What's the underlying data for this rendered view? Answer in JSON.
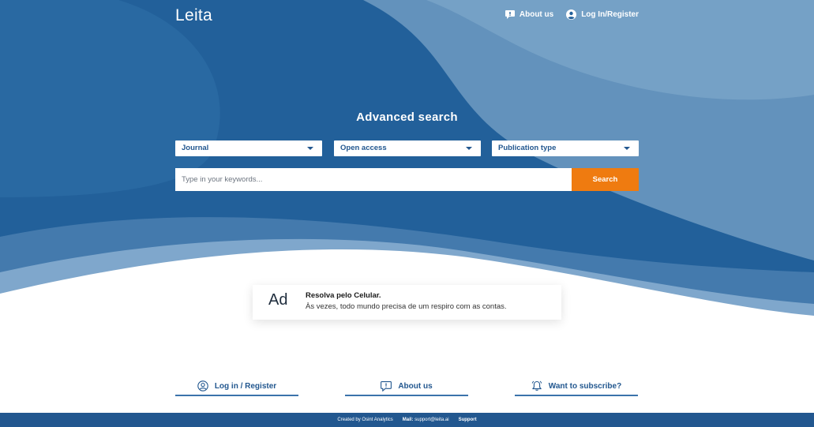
{
  "app": {
    "logo": "Leita"
  },
  "header": {
    "nav": [
      {
        "label": "About us",
        "icon": "speech-bubble-icon"
      },
      {
        "label": "Log In/Register",
        "icon": "user-circle-icon"
      }
    ]
  },
  "search": {
    "title": "Advanced search",
    "filters": [
      {
        "label": "Journal"
      },
      {
        "label": "Open access"
      },
      {
        "label": "Publication type"
      }
    ],
    "placeholder": "Type in your keywords...",
    "button_label": "Search"
  },
  "ad": {
    "tag": "Ad",
    "title": "Resolva pelo Celular.",
    "text": "Às vezes, todo mundo precisa de um respiro com as contas."
  },
  "footer_links": [
    {
      "label": "Log in / Register",
      "icon": "user-circle-icon"
    },
    {
      "label": "About us",
      "icon": "speech-bubble-icon"
    },
    {
      "label": "Want to subscribe?",
      "icon": "bell-icon"
    }
  ],
  "footer": {
    "created_by": "Created by Osint Analytics",
    "mail_label": "Mail:",
    "mail": "support@leita.ai",
    "support": "Support"
  },
  "colors": {
    "primary_blue": "#22578f",
    "light_blue": "#6a98c0",
    "accent_orange": "#ef7b10",
    "white": "#ffffff"
  }
}
